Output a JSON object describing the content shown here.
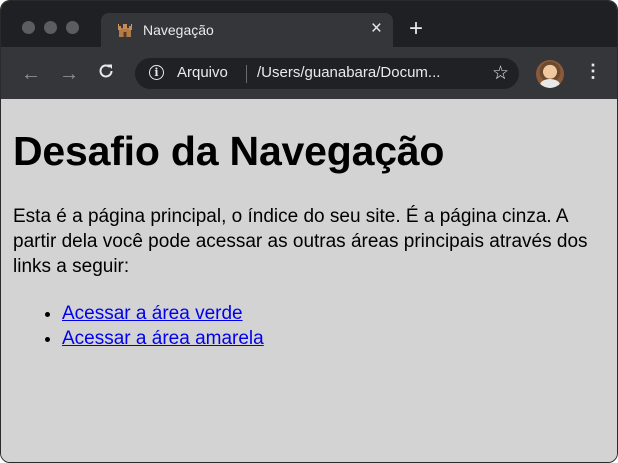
{
  "browser": {
    "tab": {
      "title": "Navegação",
      "close_glyph": "×",
      "favicon": "castle-icon"
    },
    "new_tab_glyph": "+",
    "nav": {
      "back_glyph": "←",
      "forward_glyph": "→",
      "reload_glyph": "C"
    },
    "omnibox": {
      "info_glyph": "i",
      "security_label": "Arquivo",
      "url": "/Users/guanabara/Docum...",
      "star_glyph": "☆"
    },
    "menu_glyph": "⋮"
  },
  "page": {
    "title": "Desafio da Navegação",
    "intro": "Esta é a página principal, o índice do seu site. É a página cinza. A partir dela você pode acessar as outras áreas principais através dos links a seguir:",
    "links": [
      {
        "label": "Acessar a área verde"
      },
      {
        "label": "Acessar a área amarela"
      }
    ],
    "background_color": "#d3d3d3",
    "link_color": "#0000ee"
  }
}
